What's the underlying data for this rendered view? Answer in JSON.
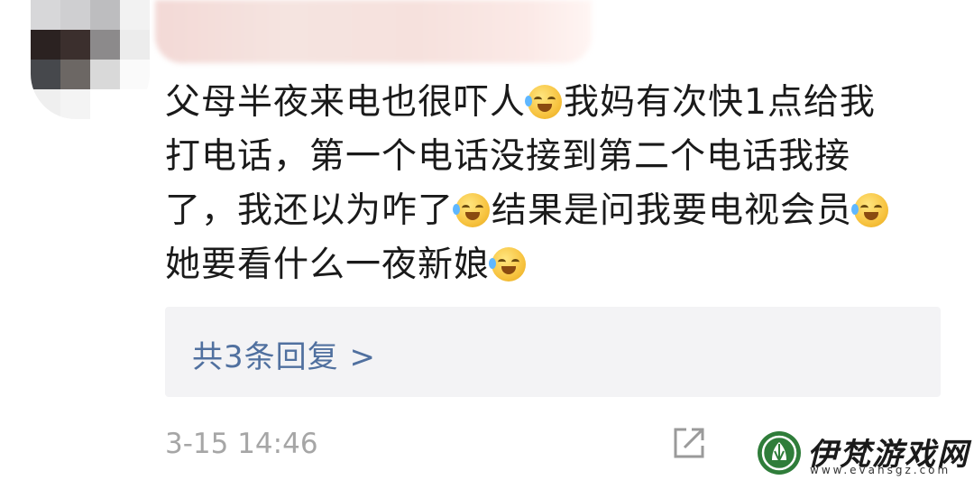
{
  "comment": {
    "text_segments": [
      "父母半夜来电也很吓人",
      "我妈有次快1点给我",
      "打电话，第一个电话没接到第二个电话我接",
      "了，我还以为咋了",
      "结果是问我要电视会员",
      "她要看什么一夜新娘"
    ],
    "emoji_name": "laughing-crying-emoji"
  },
  "replies": {
    "label": "共3条回复 >"
  },
  "meta": {
    "timestamp": "3-15 14:46"
  },
  "watermark": {
    "site_name": "伊梵游戏网",
    "site_url": "www.evansgz.com"
  },
  "colors": {
    "link": "#50709f",
    "timestamp": "#a6a6a6",
    "reply_box_bg": "#f3f3f5",
    "watermark_green": "#2f7d3a"
  }
}
